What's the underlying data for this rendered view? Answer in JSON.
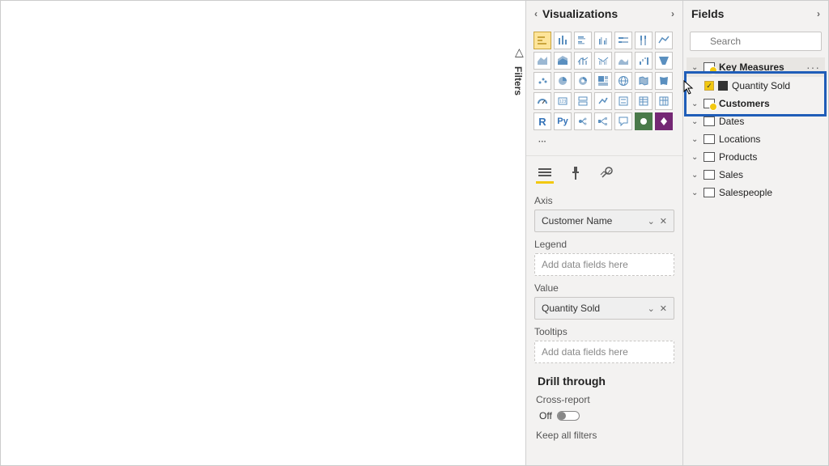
{
  "filters": {
    "label": "Filters"
  },
  "viz": {
    "title": "Visualizations",
    "wells": {
      "axis": {
        "label": "Axis",
        "value": "Customer Name"
      },
      "legend": {
        "label": "Legend",
        "placeholder": "Add data fields here"
      },
      "value": {
        "label": "Value",
        "value": "Quantity Sold"
      },
      "tooltips": {
        "label": "Tooltips",
        "placeholder": "Add data fields here"
      }
    },
    "drill": {
      "title": "Drill through",
      "cross_report": "Cross-report",
      "off": "Off",
      "keep_all": "Keep all filters"
    }
  },
  "fields": {
    "title": "Fields",
    "search_placeholder": "Search",
    "tables": {
      "key_measures": {
        "label": "Key Measures",
        "child": "Quantity Sold"
      },
      "customers": "Customers",
      "dates": "Dates",
      "locations": "Locations",
      "products": "Products",
      "sales": "Sales",
      "salespeople": "Salespeople"
    }
  }
}
